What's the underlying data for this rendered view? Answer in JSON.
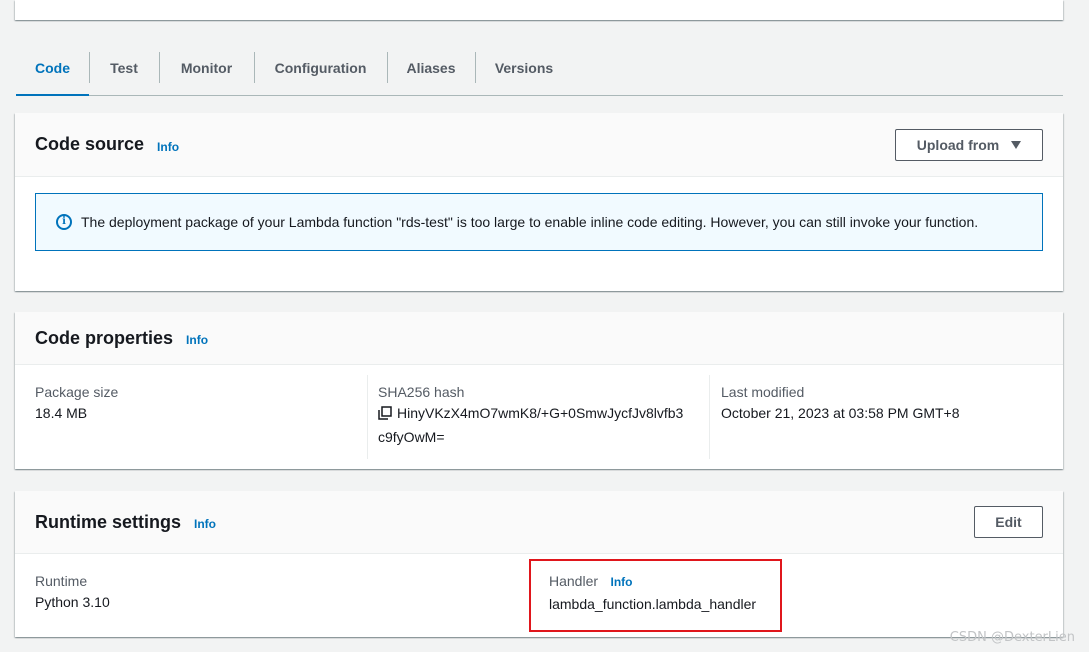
{
  "tabs": [
    {
      "label": "Code",
      "active": true
    },
    {
      "label": "Test",
      "active": false
    },
    {
      "label": "Monitor",
      "active": false
    },
    {
      "label": "Configuration",
      "active": false
    },
    {
      "label": "Aliases",
      "active": false
    },
    {
      "label": "Versions",
      "active": false
    }
  ],
  "code_source": {
    "title": "Code source",
    "info": "Info",
    "upload_button": "Upload from",
    "alert_icon": "info-circle-icon",
    "alert_text": "The deployment package of your Lambda function \"rds-test\" is too large to enable inline code editing. However, you can still invoke your function."
  },
  "code_properties": {
    "title": "Code properties",
    "info": "Info",
    "package_size_label": "Package size",
    "package_size_value": "18.4 MB",
    "sha_label": "SHA256 hash",
    "copy_icon": "copy-icon",
    "sha_line1": "HinyVKzX4mO7wmK8/+G+0SmwJycfJv8lvfb3",
    "sha_line2": "c9fyOwM=",
    "modified_label": "Last modified",
    "modified_value": "October 21, 2023 at 03:58 PM GMT+8"
  },
  "runtime_settings": {
    "title": "Runtime settings",
    "info": "Info",
    "edit_button": "Edit",
    "runtime_label": "Runtime",
    "runtime_value": "Python 3.10",
    "handler_label": "Handler",
    "handler_info": "Info",
    "handler_value": "lambda_function.lambda_handler"
  },
  "watermark": "CSDN @DexterLien",
  "colors": {
    "accent": "#0073bb",
    "highlight": "#e0161c"
  }
}
